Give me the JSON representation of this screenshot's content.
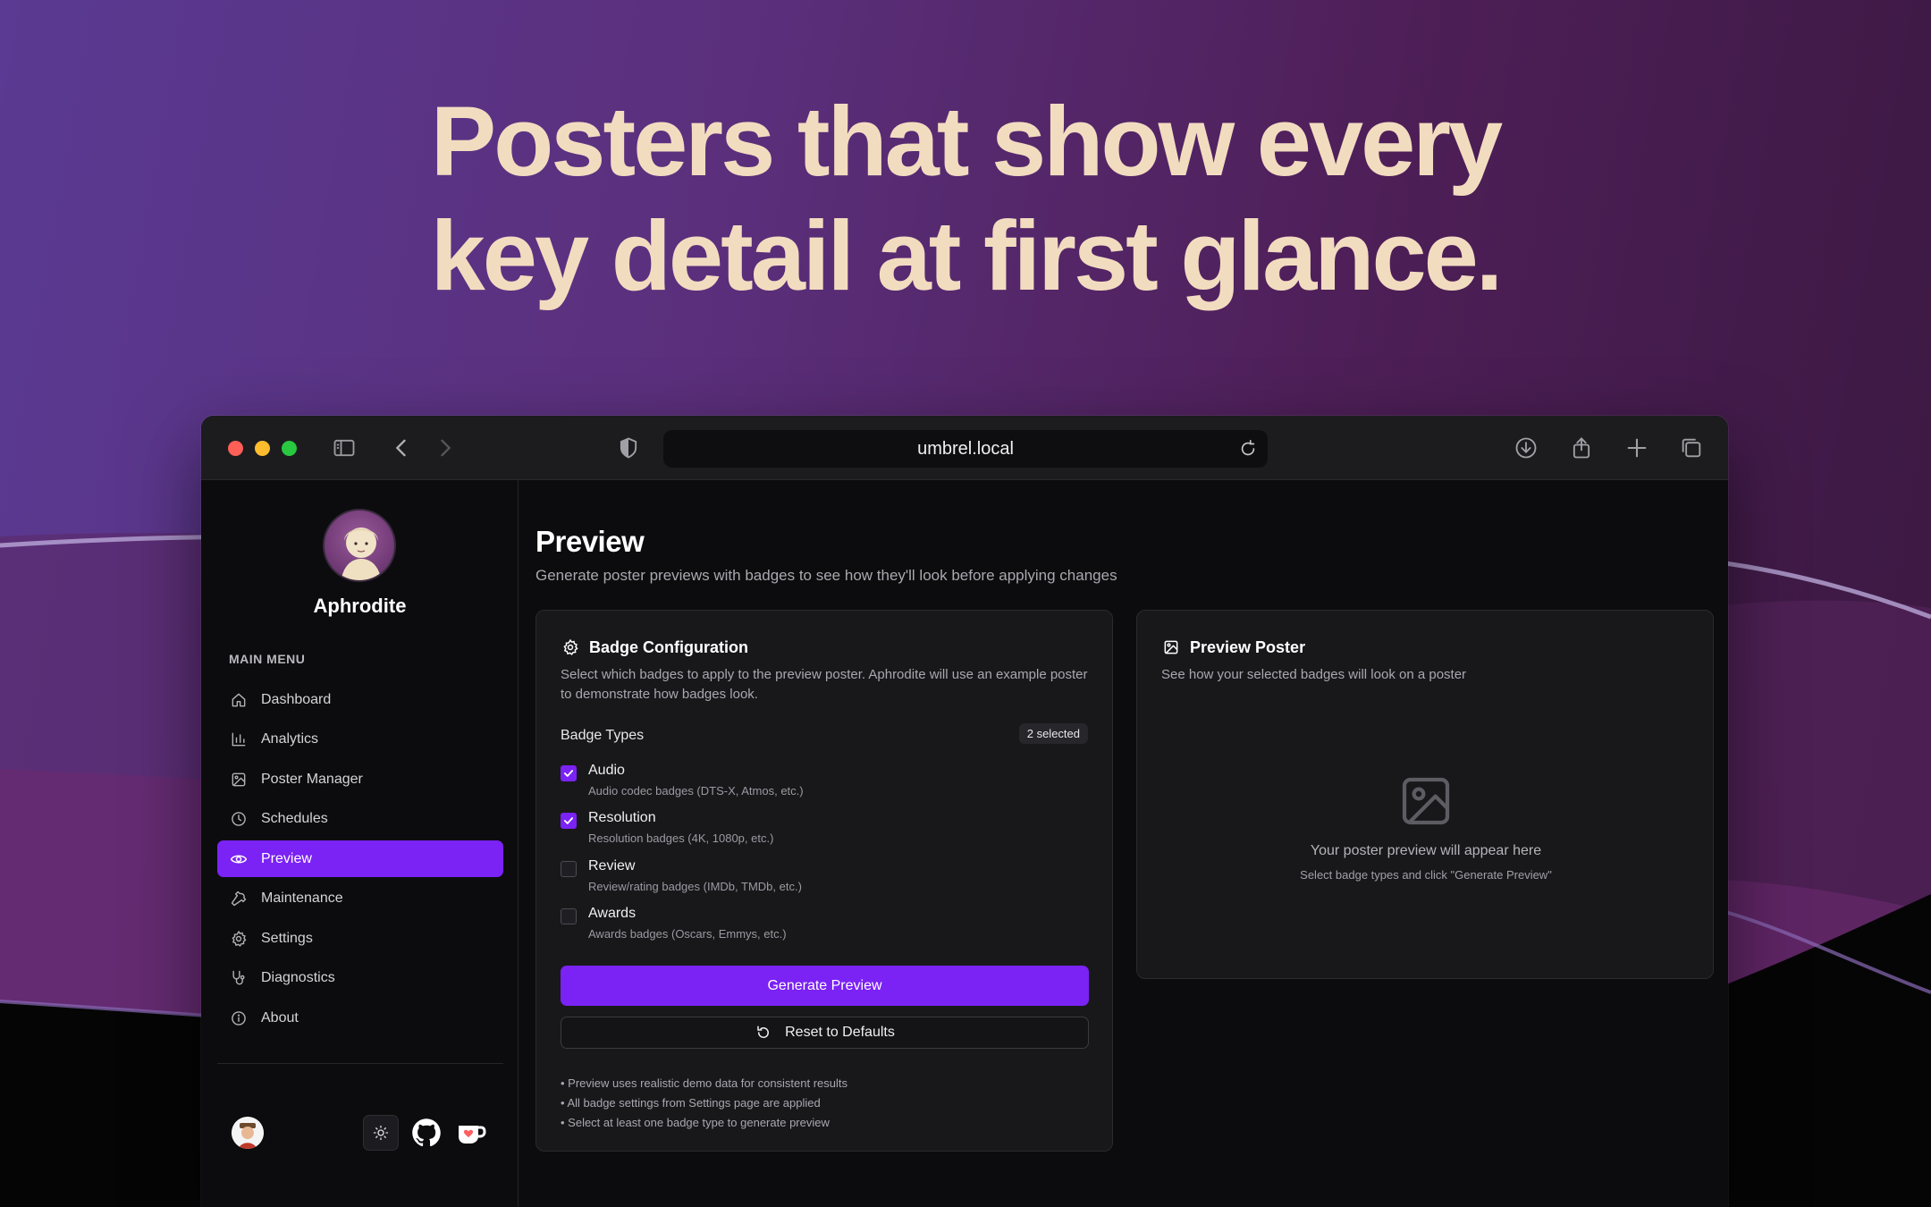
{
  "hero": {
    "line1": "Posters that show every",
    "line2": "key detail at first glance."
  },
  "browser": {
    "url": "umbrel.local",
    "icons": [
      "sidebar-toggle-icon",
      "back-icon",
      "forward-icon",
      "shield-icon",
      "reload-icon",
      "download-icon",
      "share-icon",
      "new-tab-icon",
      "tabs-overview-icon"
    ]
  },
  "sidebar": {
    "app_name": "Aphrodite",
    "menu_title": "MAIN MENU",
    "items": [
      {
        "label": "Dashboard",
        "icon": "home-icon"
      },
      {
        "label": "Analytics",
        "icon": "bar-chart-icon"
      },
      {
        "label": "Poster Manager",
        "icon": "image-icon"
      },
      {
        "label": "Schedules",
        "icon": "clock-icon"
      },
      {
        "label": "Preview",
        "icon": "eye-icon",
        "active": true
      },
      {
        "label": "Maintenance",
        "icon": "wrench-icon"
      },
      {
        "label": "Settings",
        "icon": "gear-icon"
      },
      {
        "label": "Diagnostics",
        "icon": "stethoscope-icon"
      },
      {
        "label": "About",
        "icon": "info-icon"
      }
    ],
    "footer_icons": [
      "user-avatar",
      "theme-toggle-icon",
      "github-icon",
      "ko-fi-icon"
    ]
  },
  "main": {
    "title": "Preview",
    "subtitle": "Generate poster previews with badges to see how they'll look before applying changes"
  },
  "badge_config": {
    "title": "Badge Configuration",
    "description": "Select which badges to apply to the preview poster. Aphrodite will use an example poster to demonstrate how badges look.",
    "types_label": "Badge Types",
    "selected_count": "2 selected",
    "options": [
      {
        "label": "Audio",
        "hint": "Audio codec badges (DTS-X, Atmos, etc.)",
        "checked": true
      },
      {
        "label": "Resolution",
        "hint": "Resolution badges (4K, 1080p, etc.)",
        "checked": true
      },
      {
        "label": "Review",
        "hint": "Review/rating badges (IMDb, TMDb, etc.)",
        "checked": false
      },
      {
        "label": "Awards",
        "hint": "Awards badges (Oscars, Emmys, etc.)",
        "checked": false
      }
    ],
    "generate_label": "Generate Preview",
    "reset_label": "Reset to Defaults",
    "notes": [
      "• Preview uses realistic demo data for consistent results",
      "• All badge settings from Settings page are applied",
      "• Select at least one badge type to generate preview"
    ]
  },
  "preview_poster": {
    "title": "Preview Poster",
    "description": "See how your selected badges will look on a poster",
    "placeholder_title": "Your poster preview will appear here",
    "placeholder_sub": "Select badge types and click \"Generate Preview\""
  },
  "colors": {
    "accent": "#7b22f5",
    "hero_text": "#f2dcc0"
  }
}
